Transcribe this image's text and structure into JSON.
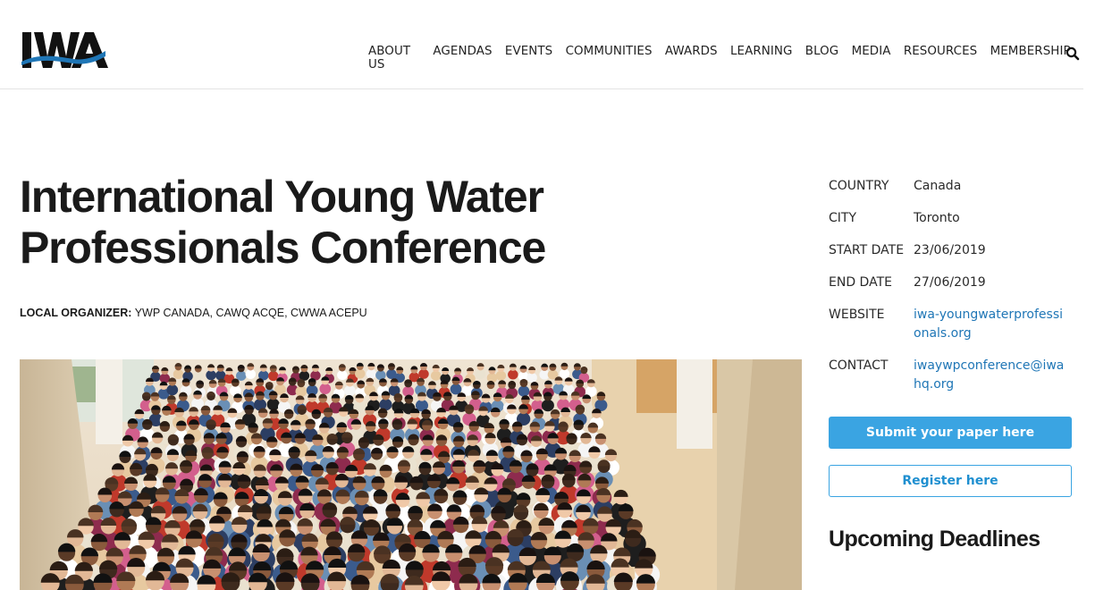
{
  "brand": {
    "logo_text": "IWA",
    "accent": "#1f76b6",
    "button_blue": "#3aa4e2"
  },
  "nav": {
    "items": [
      "ABOUT US",
      "AGENDAS",
      "EVENTS",
      "COMMUNITIES",
      "AWARDS",
      "LEARNING",
      "BLOG",
      "MEDIA",
      "RESOURCES",
      "MEMBERSHIP"
    ],
    "search_icon": "search-icon"
  },
  "event": {
    "title": "International Young Water Professionals Conference",
    "organizer_label": "LOCAL ORGANIZER:",
    "organizer_value": "YWP CANADA, CAWQ ACQE, CWWA ACEPU"
  },
  "details": [
    {
      "key": "COUNTRY",
      "value": "Canada"
    },
    {
      "key": "CITY",
      "value": "Toronto"
    },
    {
      "key": "START DATE",
      "value": "23/06/2019"
    },
    {
      "key": "END DATE",
      "value": "27/06/2019"
    },
    {
      "key": "WEBSITE",
      "value": "iwa-youngwaterprofessionals.org"
    },
    {
      "key": "CONTACT",
      "value": "iwaywpconference@iwahq.org"
    }
  ],
  "actions": {
    "submit_label": "Submit your paper here",
    "register_label": "Register here"
  },
  "sidebar": {
    "deadlines_heading": "Upcoming Deadlines"
  }
}
